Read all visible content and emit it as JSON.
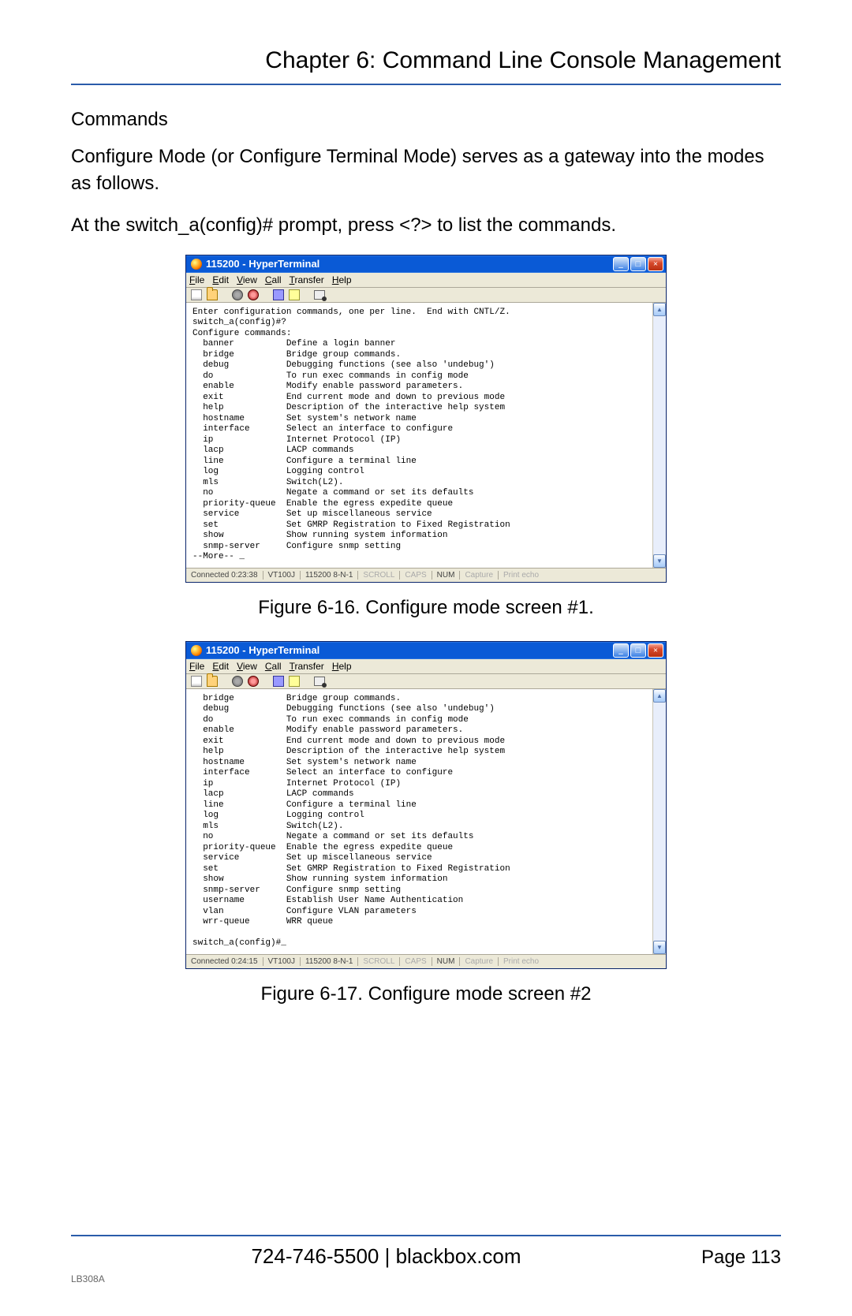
{
  "chapter_title": "Chapter 6: Command Line Console Management",
  "section_heading": "Commands",
  "paragraph1": "Configure Mode (or Configure Terminal Mode) serves as a gateway into the modes as follows.",
  "paragraph2": "At the switch_a(config)# prompt, press <?> to list the commands.",
  "figures": {
    "fig1": {
      "window_title": "115200 - HyperTerminal",
      "menubar": [
        "File",
        "Edit",
        "View",
        "Call",
        "Transfer",
        "Help"
      ],
      "terminal_text": "Enter configuration commands, one per line.  End with CNTL/Z.\nswitch_a(config)#?\nConfigure commands:\n  banner          Define a login banner\n  bridge          Bridge group commands.\n  debug           Debugging functions (see also 'undebug')\n  do              To run exec commands in config mode\n  enable          Modify enable password parameters.\n  exit            End current mode and down to previous mode\n  help            Description of the interactive help system\n  hostname        Set system's network name\n  interface       Select an interface to configure\n  ip              Internet Protocol (IP)\n  lacp            LACP commands\n  line            Configure a terminal line\n  log             Logging control\n  mls             Switch(L2).\n  no              Negate a command or set its defaults\n  priority-queue  Enable the egress expedite queue\n  service         Set up miscellaneous service\n  set             Set GMRP Registration to Fixed Registration\n  show            Show running system information\n  snmp-server     Configure snmp setting\n--More-- _",
      "status": {
        "conn": "Connected 0:23:38",
        "term": "VT100J",
        "params": "115200 8-N-1",
        "scroll": "SCROLL",
        "caps": "CAPS",
        "num": "NUM",
        "capture": "Capture",
        "echo": "Print echo"
      },
      "caption": "Figure 6-16. Configure mode screen #1."
    },
    "fig2": {
      "window_title": "115200 - HyperTerminal",
      "menubar": [
        "File",
        "Edit",
        "View",
        "Call",
        "Transfer",
        "Help"
      ],
      "terminal_text": "  bridge          Bridge group commands.\n  debug           Debugging functions (see also 'undebug')\n  do              To run exec commands in config mode\n  enable          Modify enable password parameters.\n  exit            End current mode and down to previous mode\n  help            Description of the interactive help system\n  hostname        Set system's network name\n  interface       Select an interface to configure\n  ip              Internet Protocol (IP)\n  lacp            LACP commands\n  line            Configure a terminal line\n  log             Logging control\n  mls             Switch(L2).\n  no              Negate a command or set its defaults\n  priority-queue  Enable the egress expedite queue\n  service         Set up miscellaneous service\n  set             Set GMRP Registration to Fixed Registration\n  show            Show running system information\n  snmp-server     Configure snmp setting\n  username        Establish User Name Authentication\n  vlan            Configure VLAN parameters\n  wrr-queue       WRR queue\n\nswitch_a(config)#_",
      "status": {
        "conn": "Connected 0:24:15",
        "term": "VT100J",
        "params": "115200 8-N-1",
        "scroll": "SCROLL",
        "caps": "CAPS",
        "num": "NUM",
        "capture": "Capture",
        "echo": "Print echo"
      },
      "caption": "Figure 6-17. Configure mode screen #2"
    }
  },
  "footer": {
    "contact": "724-746-5500   |   blackbox.com",
    "page_label": "Page 113",
    "model": "LB308A"
  }
}
